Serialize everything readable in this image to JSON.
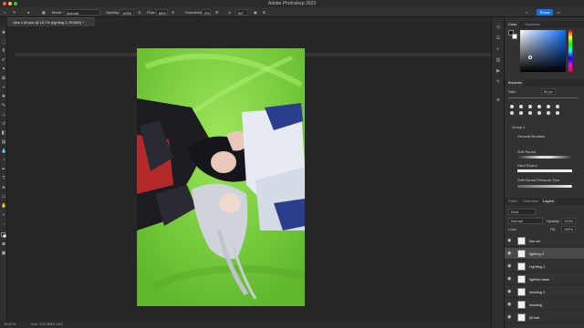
{
  "window": {
    "title": "Adobe Photoshop 2023"
  },
  "options_bar": {
    "mode_label": "Mode:",
    "mode_value": "Normal",
    "opacity_label": "Opacity:",
    "opacity_value": "100%",
    "flow_label": "Flow:",
    "flow_value": "85%",
    "smoothing_label": "Smoothing:",
    "smoothing_value": "0%",
    "angle_value": "90°",
    "share_label": "Share"
  },
  "document": {
    "tab_label": "clive c jill.psd @ 16.7% (lighting 3, RGB/8) *",
    "status_zoom": "16.67%",
    "status_doc": "Doc: 102.9M/2.14G"
  },
  "color_panel": {
    "tabs": [
      "Color",
      "Swatches"
    ]
  },
  "brushes_panel": {
    "title": "Brushes",
    "size_label": "Size",
    "size_value": "50 px",
    "group_label": "Group 1",
    "subgroup_label": "General Brushes",
    "brushes": [
      "Soft Round",
      "Hard Round",
      "Soft Round Pressure Size"
    ]
  },
  "layers_panel": {
    "tabs": [
      "Paths",
      "Channels",
      "Layers"
    ],
    "kind_label": "Kind",
    "blend_value": "Normal",
    "opacity_label": "Opacity:",
    "opacity_value": "100%",
    "lock_label": "Lock:",
    "fill_label": "Fill:",
    "fill_value": "100%",
    "layers": [
      {
        "name": "line art",
        "selected": false
      },
      {
        "name": "lighting 3",
        "selected": true
      },
      {
        "name": "Lighting 2",
        "selected": false
      },
      {
        "name": "lightish base",
        "selected": false
      },
      {
        "name": "shading 2",
        "selected": false
      },
      {
        "name": "shading",
        "selected": false
      },
      {
        "name": "jill hair",
        "selected": false
      }
    ]
  },
  "colors": {
    "canvas_bg": "#7ad33d",
    "accent": "#1473e6"
  }
}
